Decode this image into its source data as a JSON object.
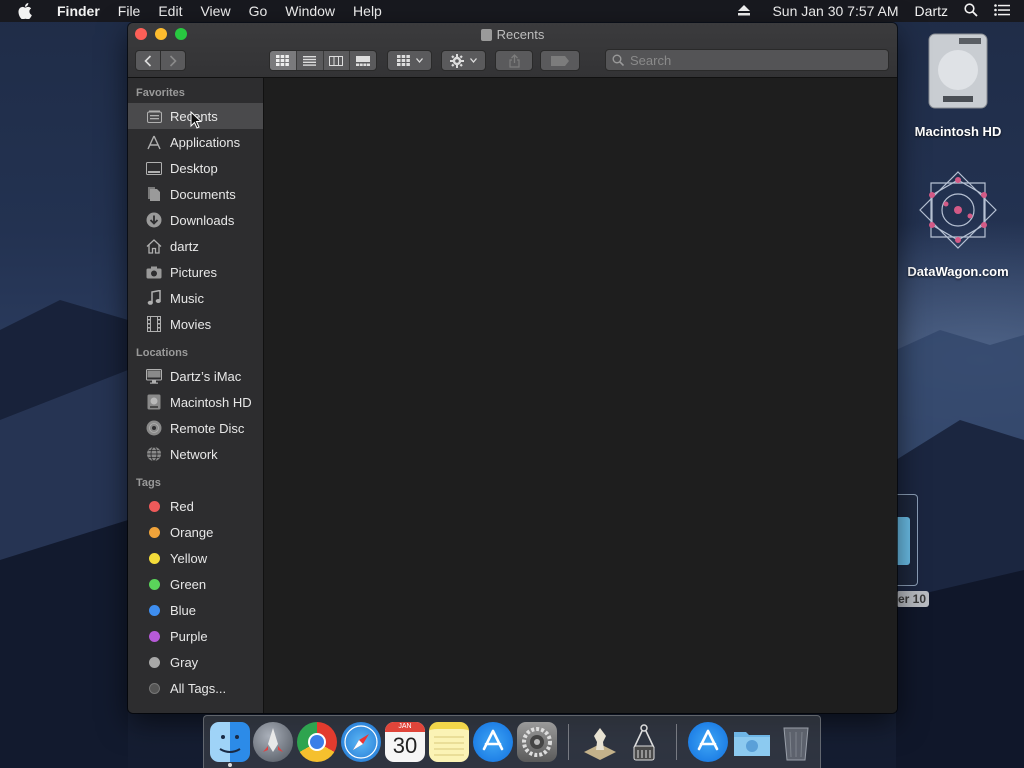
{
  "menubar": {
    "app_name": "Finder",
    "menus": [
      "File",
      "Edit",
      "View",
      "Go",
      "Window",
      "Help"
    ],
    "datetime": "Sun Jan 30  7:57 AM",
    "user": "Dartz"
  },
  "window": {
    "title": "Recents",
    "search_placeholder": "Search"
  },
  "sidebar": {
    "favorites_header": "Favorites",
    "favorites": [
      {
        "label": "Recents",
        "icon": "recents-icon"
      },
      {
        "label": "Applications",
        "icon": "applications-icon"
      },
      {
        "label": "Desktop",
        "icon": "desktop-icon"
      },
      {
        "label": "Documents",
        "icon": "documents-icon"
      },
      {
        "label": "Downloads",
        "icon": "downloads-icon"
      },
      {
        "label": "dartz",
        "icon": "home-icon"
      },
      {
        "label": "Pictures",
        "icon": "camera-icon"
      },
      {
        "label": "Music",
        "icon": "music-note-icon"
      },
      {
        "label": "Movies",
        "icon": "film-icon"
      }
    ],
    "locations_header": "Locations",
    "locations": [
      {
        "label": "Dartz’s iMac",
        "icon": "imac-icon"
      },
      {
        "label": "Macintosh HD",
        "icon": "hard-drive-icon"
      },
      {
        "label": "Remote Disc",
        "icon": "disc-icon"
      },
      {
        "label": "Network",
        "icon": "globe-icon"
      }
    ],
    "tags_header": "Tags",
    "tags": [
      {
        "label": "Red",
        "color": "#ee5a5a"
      },
      {
        "label": "Orange",
        "color": "#f0a33a"
      },
      {
        "label": "Yellow",
        "color": "#f4dc3a"
      },
      {
        "label": "Green",
        "color": "#5ad45a"
      },
      {
        "label": "Blue",
        "color": "#3e8ef0"
      },
      {
        "label": "Purple",
        "color": "#b65ad8"
      },
      {
        "label": "Gray",
        "color": "#a8a8a8"
      },
      {
        "label": "All Tags...",
        "color": "#555555"
      }
    ]
  },
  "desktop": {
    "icons": [
      {
        "label": "Macintosh HD",
        "icon": "hard-drive-icon"
      },
      {
        "label": "DataWagon.com",
        "icon": "geometric-mandala-icon"
      },
      {
        "label": "er 10",
        "icon": "folder-icon"
      }
    ]
  },
  "dock": {
    "apps": [
      {
        "name": "finder-icon",
        "color": "#3b8ff0"
      },
      {
        "name": "launchpad-icon",
        "color": "#6a6f78"
      },
      {
        "name": "chrome-icon",
        "color": "#e8e8e8"
      },
      {
        "name": "safari-icon",
        "color": "#2f8de8"
      },
      {
        "name": "calendar-icon",
        "color": "#f4f4f4"
      },
      {
        "name": "notes-icon",
        "color": "#f7e27a"
      },
      {
        "name": "app-store-icon",
        "color": "#1e8cf0"
      },
      {
        "name": "system-preferences-icon",
        "color": "#8a8a8a"
      },
      {
        "name": "chess-icon",
        "color": "#b59a6a"
      },
      {
        "name": "screenshot-tool-icon",
        "color": "#5a5a5a"
      },
      {
        "name": "app-store-folder-icon",
        "color": "#1e8cf0"
      },
      {
        "name": "downloads-folder-icon",
        "color": "#5aa0d8"
      },
      {
        "name": "trash-icon",
        "color": "#4a4a4a"
      }
    ],
    "calendar_month": "JAN",
    "calendar_day": "30"
  }
}
